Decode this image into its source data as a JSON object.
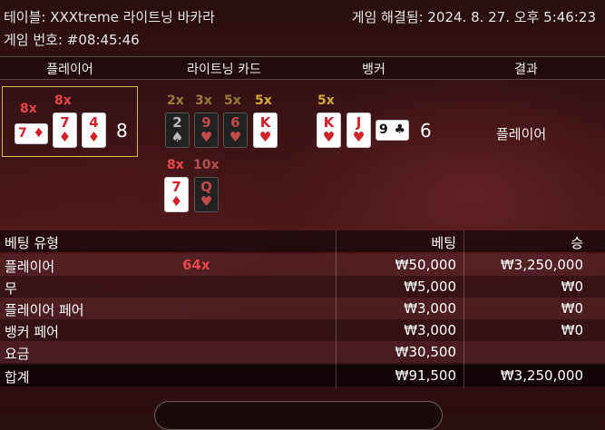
{
  "top": {
    "table_label": "테이블: XXXtreme 라이트닝 바카라",
    "game_id_label": "게임 번호: #08:45:46",
    "resolved_label": "게임 해결됨: 2024. 8. 27. 오후 5:46:23"
  },
  "columns": {
    "player": "플레이어",
    "lightning": "라이트닝 카드",
    "banker": "뱅커",
    "result": "결과"
  },
  "player": {
    "mult_a": "8x",
    "mult_b": "8x",
    "cards": [
      {
        "rank": "7",
        "suit": "♦",
        "color": "#d0202a"
      },
      {
        "rank": "7",
        "suit": "♦",
        "color": "#d0202a"
      },
      {
        "rank": "4",
        "suit": "♦",
        "color": "#d0202a"
      }
    ],
    "score": "8"
  },
  "lightning": {
    "row1_mults": [
      "2x",
      "3x",
      "5x",
      "5x"
    ],
    "row1_cards": [
      {
        "rank": "2",
        "suit": "♠"
      },
      {
        "rank": "9",
        "suit": "♥"
      },
      {
        "rank": "6",
        "suit": "♥"
      },
      {
        "rank": "K",
        "suit": "♥"
      }
    ],
    "row2_mults": [
      "8x",
      "10x"
    ],
    "row2_cards": [
      {
        "rank": "7",
        "suit": "♦"
      },
      {
        "rank": "Q",
        "suit": "♥"
      }
    ]
  },
  "banker": {
    "mult": "5x",
    "cards": [
      {
        "rank": "K",
        "suit": "♥"
      },
      {
        "rank": "J",
        "suit": "♥"
      },
      {
        "rank": "9",
        "suit": "♣"
      }
    ],
    "score": "6"
  },
  "result_text": "플레이어",
  "bets_table": {
    "headers": {
      "type": "베팅 유형",
      "bet": "베팅",
      "win": "승"
    },
    "rows": [
      {
        "type": "플레이어",
        "mult": "64x",
        "bet": "₩50,000",
        "win": "₩3,250,000"
      },
      {
        "type": "무",
        "mult": "",
        "bet": "₩5,000",
        "win": "₩0"
      },
      {
        "type": "플레이어 페어",
        "mult": "",
        "bet": "₩3,000",
        "win": "₩0"
      },
      {
        "type": "뱅커 페어",
        "mult": "",
        "bet": "₩3,000",
        "win": "₩0"
      },
      {
        "type": "요금",
        "mult": "",
        "bet": "₩30,500",
        "win": ""
      }
    ],
    "total": {
      "type": "합계",
      "bet": "₩91,500",
      "win": "₩3,250,000"
    }
  }
}
